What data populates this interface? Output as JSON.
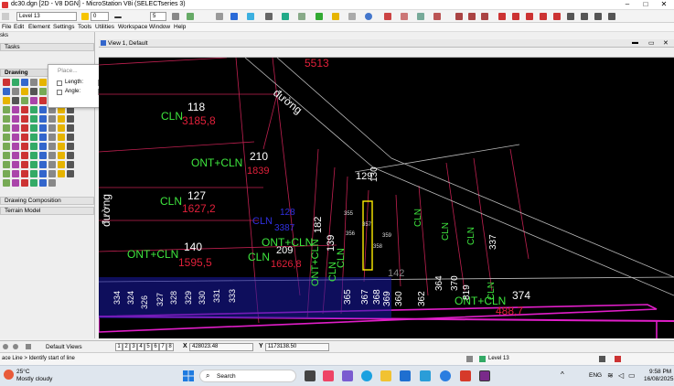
{
  "window": {
    "title": "dc30.dgn [2D - V8 DGN] - MicroStation V8i (SELECTseries 3)"
  },
  "toolbar": {
    "level_combo": "Level 13",
    "color_value": "0",
    "weight_value": "5"
  },
  "menu": [
    "File",
    "Edit",
    "Element",
    "Settings",
    "Tools",
    "Utilities",
    "Workspace",
    "Window",
    "Help"
  ],
  "left_panel": {
    "tasks_label": "Tasks",
    "drawing_label": "Drawing",
    "drawing_composition_label": "Drawing Composition",
    "terrain_model_label": "Terrain Model",
    "tab_label": "sks"
  },
  "place_dialog": {
    "title": "Place...",
    "length_label": "Length:",
    "angle_label": "Angle:"
  },
  "view": {
    "title": "View 1, Default"
  },
  "drawing": {
    "labels": [
      {
        "text": "5513",
        "color": "#e0203a"
      },
      {
        "text": "CLN",
        "color": "#3ee63e"
      },
      {
        "text": "118",
        "color": "#ffffff"
      },
      {
        "text": "3185,8",
        "color": "#e0203a"
      },
      {
        "text": "đường",
        "color": "#ffffff"
      },
      {
        "text": "ONT+CLN",
        "color": "#3ee63e"
      },
      {
        "text": "210",
        "color": "#ffffff"
      },
      {
        "text": "1839",
        "color": "#e0203a"
      },
      {
        "text": "CLN",
        "color": "#3ee63e"
      },
      {
        "text": "127",
        "color": "#ffffff"
      },
      {
        "text": "1627,2",
        "color": "#e0203a"
      },
      {
        "text": "đường",
        "color": "#ffffff"
      },
      {
        "text": "CLN",
        "color": "#3030e0"
      },
      {
        "text": "128",
        "color": "#3030e0"
      },
      {
        "text": "3387",
        "color": "#3030e0"
      },
      {
        "text": "ONT+CLN",
        "color": "#3ee63e"
      },
      {
        "text": "209",
        "color": "#ffffff"
      },
      {
        "text": "CLN",
        "color": "#3ee63e"
      },
      {
        "text": "1626,8",
        "color": "#e0203a"
      },
      {
        "text": "ONT+CLN",
        "color": "#3ee63e"
      },
      {
        "text": "140",
        "color": "#ffffff"
      },
      {
        "text": "1595,5",
        "color": "#e0203a"
      },
      {
        "text": "129",
        "color": "#ffffff"
      },
      {
        "text": "130",
        "color": "#ffffff"
      },
      {
        "text": "142",
        "color": "#888888"
      },
      {
        "text": "374",
        "color": "#ffffff"
      },
      {
        "text": "ONT+CLN",
        "color": "#3ee63e"
      },
      {
        "text": "488,7",
        "color": "#e0203a"
      }
    ],
    "rotated_labels": [
      {
        "text": "182",
        "color": "#ffffff"
      },
      {
        "text": "ONT+CLN",
        "color": "#3ee63e"
      },
      {
        "text": "CLN",
        "color": "#3ee63e"
      },
      {
        "text": "139",
        "color": "#ffffff"
      },
      {
        "text": "CLN",
        "color": "#3ee63e"
      },
      {
        "text": "365",
        "color": "#ffffff"
      },
      {
        "text": "367",
        "color": "#ffffff"
      },
      {
        "text": "368",
        "color": "#ffffff"
      },
      {
        "text": "369",
        "color": "#ffffff"
      },
      {
        "text": "360",
        "color": "#ffffff"
      },
      {
        "text": "362",
        "color": "#ffffff"
      },
      {
        "text": "364",
        "color": "#ffffff"
      },
      {
        "text": "370",
        "color": "#ffffff"
      },
      {
        "text": "819",
        "color": "#ffffff"
      },
      {
        "text": "CLN",
        "color": "#3ee63e"
      },
      {
        "text": "337",
        "color": "#ffffff"
      },
      {
        "text": "CLN",
        "color": "#3ee63e"
      },
      {
        "text": "CLN",
        "color": "#3ee63e"
      },
      {
        "text": "CLN",
        "color": "#3ee63e"
      },
      {
        "text": "334",
        "color": "#ffffff"
      },
      {
        "text": "324",
        "color": "#ffffff"
      },
      {
        "text": "326",
        "color": "#ffffff"
      },
      {
        "text": "327",
        "color": "#ffffff"
      },
      {
        "text": "328",
        "color": "#ffffff"
      },
      {
        "text": "329",
        "color": "#ffffff"
      },
      {
        "text": "330",
        "color": "#ffffff"
      },
      {
        "text": "331",
        "color": "#ffffff"
      },
      {
        "text": "333",
        "color": "#ffffff"
      }
    ],
    "small_labels": [
      "355",
      "356",
      "357",
      "358",
      "359"
    ]
  },
  "status": {
    "views_label": "Default Views",
    "view_buttons": [
      "1",
      "2",
      "3",
      "4",
      "5",
      "6",
      "7",
      "8"
    ],
    "x_label": "X",
    "x_value": "428023.48",
    "y_label": "Y",
    "y_value": "1173138.50",
    "level_label": "Level 13",
    "prompt": "ace Line > Identify start of line"
  },
  "taskbar": {
    "weather_temp": "25°C",
    "weather_desc": "Mostly cloudy",
    "search_placeholder": "Search",
    "lang": "ENG",
    "time": "9:58 PM",
    "date": "16/08/2025"
  }
}
